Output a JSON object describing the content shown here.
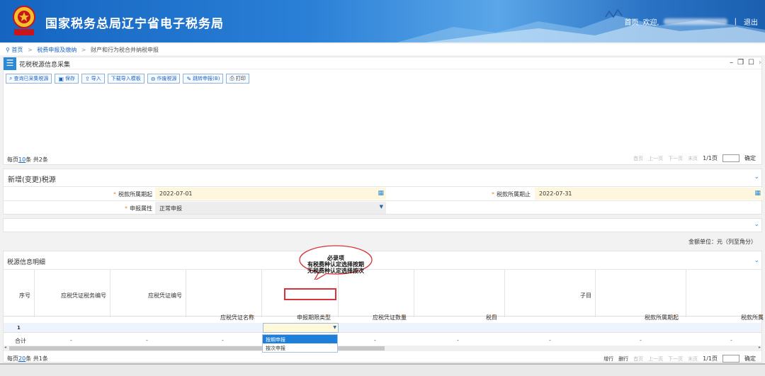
{
  "header": {
    "site_title": "国家税务总局辽宁省电子税务局",
    "home_link": "首页",
    "welcome": "欢迎,",
    "logout": "退出",
    "emblem_caption": "中国税务"
  },
  "breadcrumb": {
    "items": [
      "首页",
      "税费申报及缴纳",
      "财产和行为税合并纳税申报"
    ]
  },
  "panel_collect": {
    "title": "花税税源信息采集",
    "toolbar": [
      {
        "label": "查询已采集税源",
        "icon": "search-icon"
      },
      {
        "label": "保存",
        "icon": "save-icon"
      },
      {
        "label": "导入",
        "icon": "upload-icon"
      },
      {
        "label": "下载导入模板",
        "icon": "download-icon"
      },
      {
        "label": "作废税源",
        "icon": "void-icon"
      },
      {
        "label": "跳转申报(B)",
        "icon": "edit-icon"
      },
      {
        "label": "打印",
        "icon": "print-icon"
      }
    ],
    "pager": {
      "per_page_prefix": "每页",
      "per_page": "10",
      "per_page_suffix": "条 共2条",
      "first": "首页",
      "prev": "上一页",
      "next": "下一页",
      "last": "末页",
      "page_info": "1/1页",
      "go": "确定"
    }
  },
  "panel_new_source": {
    "title": "新增(变更)税源",
    "fields": {
      "period_start_label": "税款所属期起",
      "period_start_value": "2022-07-01",
      "period_end_label": "税款所属期止",
      "period_end_value": "2022-07-31",
      "declare_attr_label": "申报属性",
      "declare_attr_value": "正常申报"
    }
  },
  "unit_note": "金额单位：元（列至角分）",
  "panel_detail": {
    "title": "税源信息明细",
    "columns": [
      "序号",
      "应税凭证税务编号",
      "应税凭证编号",
      "应税凭证名称",
      "申报期限类型",
      "应税凭证数量",
      "税目",
      "子目",
      "税款所属期起",
      "税款所属"
    ],
    "row1_index": "1",
    "sum_label": "合计",
    "sum_dash": "-",
    "dropdown_options": [
      "按期申报",
      "按次申报"
    ],
    "pager": {
      "per_page_prefix": "每页",
      "per_page": "20",
      "per_page_suffix": "条 共1条",
      "add_row": "增行",
      "del_row": "删行",
      "first": "首页",
      "prev": "上一页",
      "next": "下一页",
      "last": "末页",
      "page_info": "1/1页",
      "go": "确定"
    }
  },
  "annotation": {
    "line1": "必录项",
    "line2": "有税费种认定选择按期",
    "line3": "无税费种认定选择按次"
  },
  "colors": {
    "header_blue": "#1565c0",
    "link_blue": "#1d64c4",
    "required_star": "#f08a24",
    "highlight_red": "#d6333a",
    "field_yellow": "#fff7dd",
    "dropdown_active": "#1d7fd9"
  }
}
